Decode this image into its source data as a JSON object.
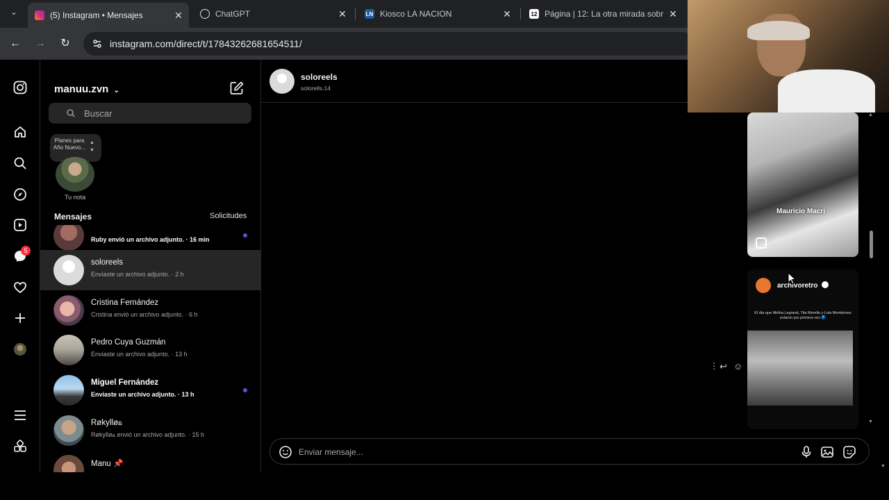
{
  "browser": {
    "tabs": [
      {
        "title": "(5) Instagram • Mensajes",
        "active": true
      },
      {
        "title": "ChatGPT",
        "active": false
      },
      {
        "title": "Kiosco LA NACION",
        "active": false
      },
      {
        "title": "Página | 12: La otra mirada sobr",
        "active": false
      }
    ],
    "favicon_ln": "LN",
    "favicon_p12": "12",
    "url": "instagram.com/direct/t/17843262681654511/"
  },
  "sidebar": {
    "notification_count": "5"
  },
  "inbox": {
    "username": "manuu.zvn",
    "search_placeholder": "Buscar",
    "note": {
      "text": "Planes para Año Nuevo...",
      "label": "Tu nota"
    },
    "messages_label": "Mensajes",
    "requests_label": "Solicitudes",
    "conversations": [
      {
        "name": "",
        "preview": "Ruby envió un archivo adjunto. · 16 min",
        "unread": true
      },
      {
        "name": "soloreels",
        "preview": "Enviaste un archivo adjunto. · 2 h",
        "unread": false,
        "selected": true
      },
      {
        "name": "Cristina Fernández",
        "preview": "Cristina envió un archivo adjunto. · 6 h",
        "unread": false
      },
      {
        "name": "Pedro Cuya Guzmán",
        "preview": "Enviaste un archivo adjunto. · 13 h",
        "unread": false
      },
      {
        "name": "Miguel Fernández",
        "preview": "Enviaste un archivo adjunto. · 13 h",
        "unread": true
      },
      {
        "name": "Røkylløᏺ",
        "preview": "Røkylløᏺ envió un archivo adjunto. · 15 h",
        "unread": false
      },
      {
        "name": "Manu 📌",
        "preview": "",
        "unread": false
      }
    ]
  },
  "chat": {
    "name": "soloreels",
    "handle": "solorells.14",
    "reel1_caption": "Mauricio Macri",
    "reel2_author": "archivoretro",
    "reel2_text": "El día que Mirtha Legrand, Tita Merello y Lola Membrives votaron por primera vez 🗳️",
    "composer_placeholder": "Enviar mensaje..."
  }
}
